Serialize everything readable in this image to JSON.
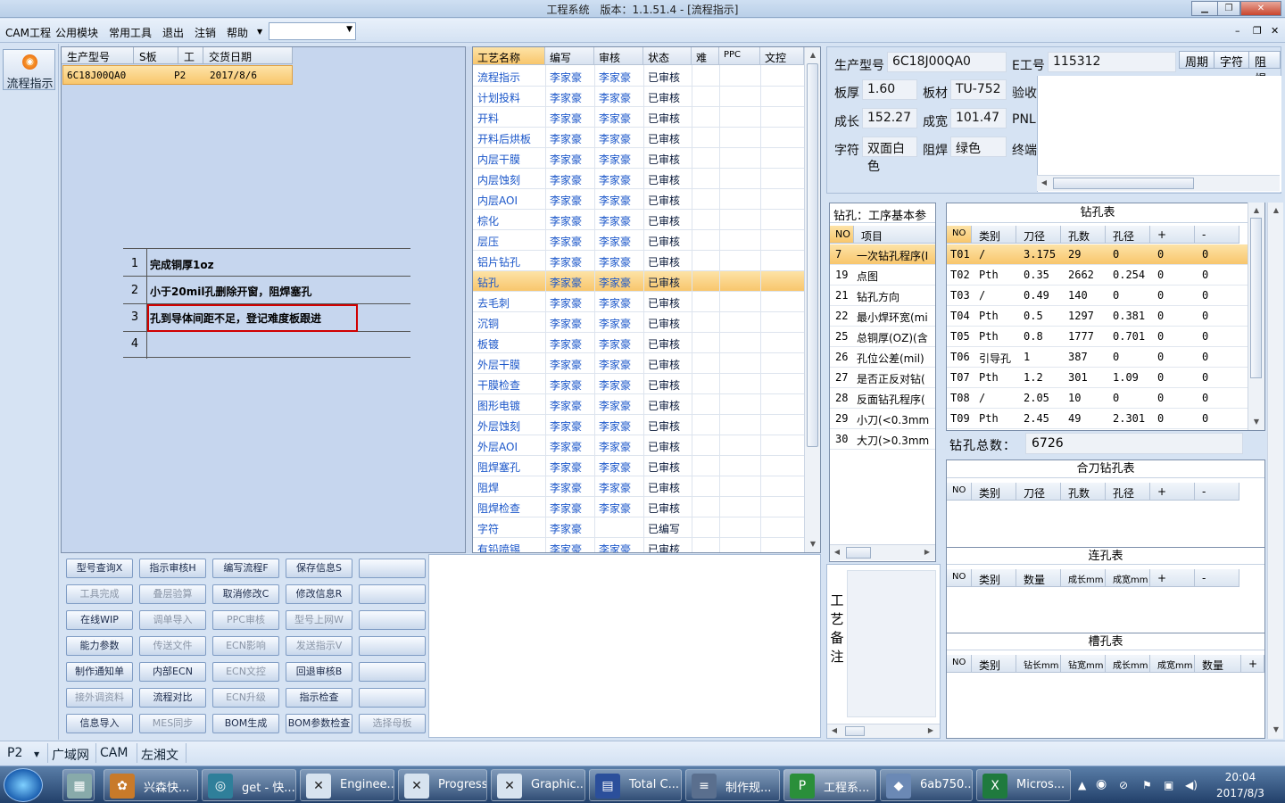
{
  "window": {
    "title": "工程系统　版本：1.1.51.4 - [流程指示]"
  },
  "menu": {
    "items": [
      "CAM工程",
      "公用模块",
      "常用工具",
      "退出",
      "注销",
      "帮助"
    ]
  },
  "sidebar": {
    "flow_button": "流程指示"
  },
  "models": {
    "columns": [
      "生产型号",
      "S板",
      "工厂",
      "交货日期"
    ],
    "rows": [
      [
        "6C18J00QA0",
        "",
        "P2",
        "2017/8/6"
      ]
    ]
  },
  "notes": [
    {
      "num": "1",
      "text": "完成铜厚1oz"
    },
    {
      "num": "2",
      "text": "小于20mil孔删除开窗，阻焊塞孔"
    },
    {
      "num": "3",
      "text": "孔到导体间距不足，登记难度板跟进"
    },
    {
      "num": "4",
      "text": ""
    }
  ],
  "buttons": [
    [
      "型号查询X",
      "指示审核H",
      "编写流程F",
      "保存信息S",
      ""
    ],
    [
      "工具完成",
      "叠层验算",
      "取消修改C",
      "修改信息R",
      ""
    ],
    [
      "在线WIP",
      "调单导入",
      "PPC审核",
      "型号上网W",
      ""
    ],
    [
      "能力参数",
      "传送文件",
      "ECN影响",
      "发送指示V",
      ""
    ],
    [
      "制作通知单",
      "内部ECN",
      "ECN文控",
      "回退审核B",
      ""
    ],
    [
      "接外调资料",
      "流程对比",
      "ECN升级",
      "指示检查",
      ""
    ],
    [
      "信息导入",
      "MES同步",
      "BOM生成",
      "BOM参数检查",
      "选择母板"
    ]
  ],
  "process": {
    "columns": [
      "工艺名称",
      "编写",
      "审核",
      "状态",
      "难",
      "PPC",
      "文控"
    ],
    "rows": [
      [
        "流程指示",
        "李家豪",
        "李家豪",
        "已审核"
      ],
      [
        "计划投料",
        "李家豪",
        "李家豪",
        "已审核"
      ],
      [
        "开料",
        "李家豪",
        "李家豪",
        "已审核"
      ],
      [
        "开料后烘板",
        "李家豪",
        "李家豪",
        "已审核"
      ],
      [
        "内层干膜",
        "李家豪",
        "李家豪",
        "已审核"
      ],
      [
        "内层蚀刻",
        "李家豪",
        "李家豪",
        "已审核"
      ],
      [
        "内层AOI",
        "李家豪",
        "李家豪",
        "已审核"
      ],
      [
        "棕化",
        "李家豪",
        "李家豪",
        "已审核"
      ],
      [
        "层压",
        "李家豪",
        "李家豪",
        "已审核"
      ],
      [
        "铝片钻孔",
        "李家豪",
        "李家豪",
        "已审核"
      ],
      [
        "钻孔",
        "李家豪",
        "李家豪",
        "已审核"
      ],
      [
        "去毛刺",
        "李家豪",
        "李家豪",
        "已审核"
      ],
      [
        "沉铜",
        "李家豪",
        "李家豪",
        "已审核"
      ],
      [
        "板镀",
        "李家豪",
        "李家豪",
        "已审核"
      ],
      [
        "外层干膜",
        "李家豪",
        "李家豪",
        "已审核"
      ],
      [
        "干膜检查",
        "李家豪",
        "李家豪",
        "已审核"
      ],
      [
        "图形电镀",
        "李家豪",
        "李家豪",
        "已审核"
      ],
      [
        "外层蚀刻",
        "李家豪",
        "李家豪",
        "已审核"
      ],
      [
        "外层AOI",
        "李家豪",
        "李家豪",
        "已审核"
      ],
      [
        "阻焊塞孔",
        "李家豪",
        "李家豪",
        "已审核"
      ],
      [
        "阻焊",
        "李家豪",
        "李家豪",
        "已审核"
      ],
      [
        "阻焊检查",
        "李家豪",
        "李家豪",
        "已审核"
      ],
      [
        "字符",
        "李家豪",
        "",
        "已编写"
      ],
      [
        "有铅喷锡",
        "李家豪",
        "李家豪",
        "已审核"
      ]
    ]
  },
  "info": {
    "prod_no_label": "生产型号",
    "prod_no": "6C18J00QA0",
    "e_no_label": "E工号",
    "e_no": "115312",
    "tabs": [
      "周期",
      "字符",
      "阻焊"
    ],
    "thick_label": "板厚",
    "thick": "1.60",
    "mat_label": "板材",
    "mat": "TU-752",
    "accept_label": "验收",
    "len_label": "成长",
    "len": "152.27",
    "wid_label": "成宽",
    "wid": "101.47",
    "pnl_label": "PNL",
    "char_label": "字符",
    "char": "双面白色",
    "mask_label": "阻焊",
    "mask": "绿色",
    "term_label": "终端"
  },
  "params": {
    "title": "钻孔：工序基本参数",
    "columns": [
      "NO",
      "项目"
    ],
    "rows": [
      [
        "7",
        "一次钻孔程序(I"
      ],
      [
        "19",
        "点图"
      ],
      [
        "21",
        "钻孔方向"
      ],
      [
        "22",
        "最小焊环宽(mi"
      ],
      [
        "25",
        "总铜厚(OZ)(含"
      ],
      [
        "26",
        "孔位公差(mil)"
      ],
      [
        "27",
        "是否正反对钻("
      ],
      [
        "28",
        "反面钻孔程序("
      ],
      [
        "29",
        "小刀(<0.3mm"
      ],
      [
        "30",
        "大刀(>0.3mm"
      ]
    ]
  },
  "drill": {
    "title": "钻孔表",
    "columns": [
      "NO",
      "类别",
      "刀径",
      "孔数",
      "孔径",
      "+",
      "-"
    ],
    "rows": [
      [
        "T01",
        "/",
        "3.175",
        "29",
        "0",
        "0",
        "0"
      ],
      [
        "T02",
        "Pth",
        "0.35",
        "2662",
        "0.254",
        "0",
        "0"
      ],
      [
        "T03",
        "/",
        "0.49",
        "140",
        "0",
        "0",
        "0"
      ],
      [
        "T04",
        "Pth",
        "0.5",
        "1297",
        "0.381",
        "0",
        "0"
      ],
      [
        "T05",
        "Pth",
        "0.8",
        "1777",
        "0.701",
        "0",
        "0"
      ],
      [
        "T06",
        "引导孔",
        "1",
        "387",
        "0",
        "0",
        "0"
      ],
      [
        "T07",
        "Pth",
        "1.2",
        "301",
        "1.09",
        "0",
        "0"
      ],
      [
        "T08",
        "/",
        "2.05",
        "10",
        "0",
        "0",
        "0"
      ],
      [
        "T09",
        "Pth",
        "2.45",
        "49",
        "2.301",
        "0",
        "0"
      ]
    ],
    "total_label": "钻孔总数：",
    "total": "6726"
  },
  "remark": {
    "label": "工艺备注"
  },
  "combo_drill": {
    "title": "合刀钻孔表",
    "columns": [
      "NO",
      "类别",
      "刀径",
      "孔数",
      "孔径",
      "+",
      "-"
    ]
  },
  "link_holes": {
    "title": "连孔表",
    "columns": [
      "NO",
      "类别",
      "数量",
      "成长mm",
      "成宽mm",
      "+",
      "-"
    ]
  },
  "slot_holes": {
    "title": "槽孔表",
    "columns": [
      "NO",
      "类别",
      "钻长mm",
      "钻宽mm",
      "成长mm",
      "成宽mm",
      "数量",
      "+"
    ]
  },
  "status": {
    "factory": "P2",
    "items": [
      "广域网",
      "CAM",
      "左湘文"
    ]
  },
  "taskbar": {
    "apps": [
      "兴森快...",
      "get - 快...",
      "Enginee...",
      "Progress",
      "Graphic...",
      "Total C...",
      "制作规...",
      "工程系...",
      "6ab750...",
      "Micros..."
    ],
    "time": "20:04",
    "date": "2017/8/3"
  },
  "colors": {
    "selection": "#f8c66c",
    "link": "#1a56c9"
  }
}
